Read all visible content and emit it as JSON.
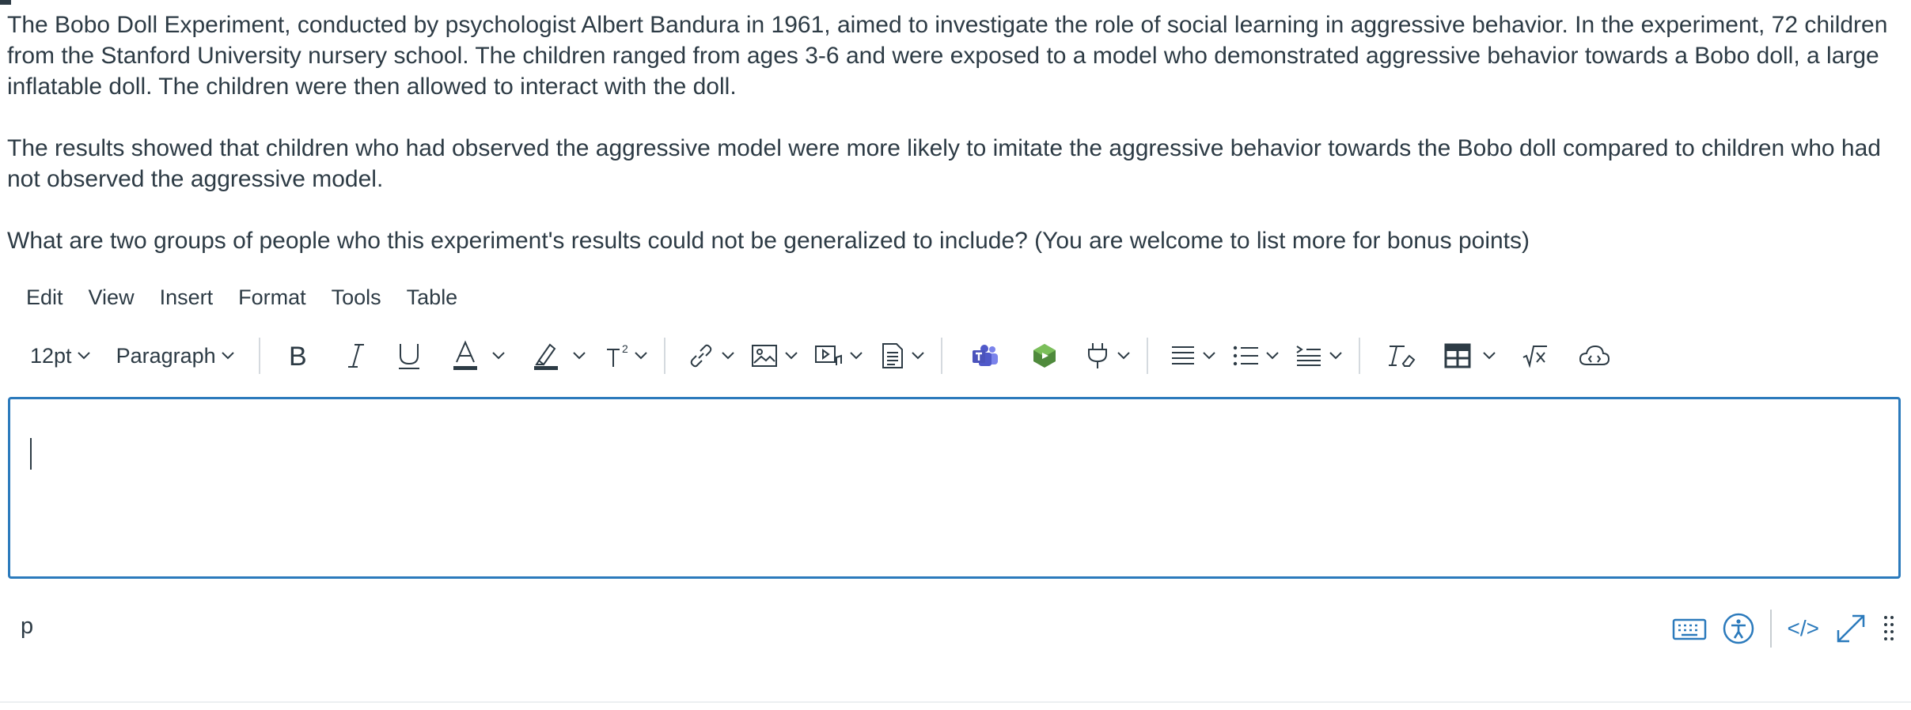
{
  "question": {
    "paragraph_1": "The Bobo Doll Experiment, conducted by psychologist Albert Bandura in 1961, aimed to investigate the role of social learning in aggressive behavior. In the experiment, 72 children from the Stanford University nursery school. The children ranged from ages 3-6 and were exposed to a model who demonstrated aggressive behavior towards a Bobo doll, a large inflatable doll. The children were then allowed to interact with the doll.",
    "paragraph_2": "The results showed that children who had observed the aggressive model were more likely to imitate the aggressive behavior towards the Bobo doll compared to children who had not observed the aggressive model.",
    "paragraph_3": "What are two groups of people who this experiment's results could not be generalized to include? (You are welcome to list more for bonus points)"
  },
  "menubar": {
    "items": [
      "Edit",
      "View",
      "Insert",
      "Format",
      "Tools",
      "Table"
    ]
  },
  "toolbar": {
    "font_size": "12pt",
    "block_format": "Paragraph",
    "icons": [
      "bold-icon",
      "italic-icon",
      "underline-icon",
      "text-color-icon",
      "highlight-icon",
      "superscript-icon",
      "link-icon",
      "image-icon",
      "media-icon",
      "document-icon",
      "teams-icon",
      "apps-icon",
      "plug-icon",
      "align-icon",
      "list-icon",
      "indent-icon",
      "clear-formatting-icon",
      "table-icon",
      "math-icon",
      "cloud-icon"
    ],
    "colors": {
      "text": "#2d3b45",
      "accent": "#2b7abc",
      "separator": "#d5dadf",
      "teams": "#5059c9",
      "apps": "#4f8a3c"
    }
  },
  "editor": {
    "content": ""
  },
  "statusbar": {
    "path": "p",
    "code_view_label": "</>"
  }
}
